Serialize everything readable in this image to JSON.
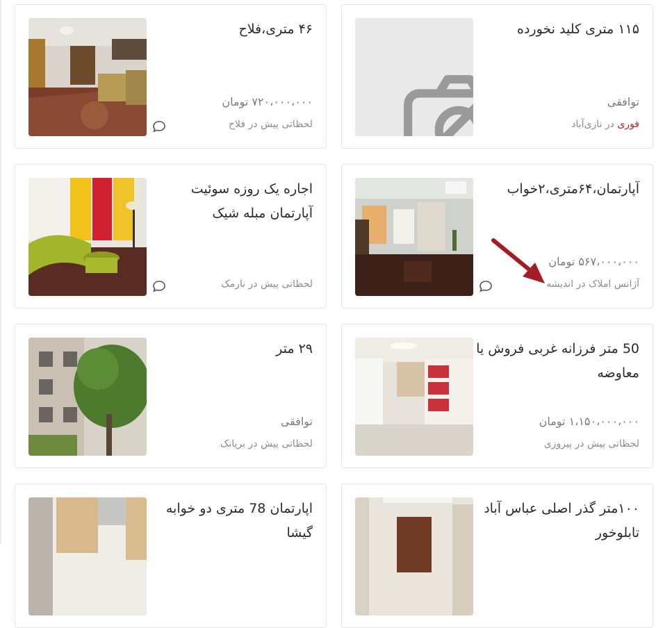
{
  "listings": [
    {
      "title": "۱۱۵ متری کلید نخورده",
      "price": "توافقی",
      "meta_urgent": "فوری",
      "meta_rest": " در نازی‌آباد",
      "has_image": false,
      "has_chat": false
    },
    {
      "title": "۴۶ متری،فلاح",
      "price": "۷۲۰،۰۰۰،۰۰۰ تومان",
      "meta_rest": "لحظاتی پیش در فلاح",
      "has_image": true,
      "has_chat": true
    },
    {
      "title": "آپارتمان،۶۴متری،۲خواب",
      "price": "۵۶۷،۰۰۰،۰۰۰ تومان",
      "meta_rest": "آژانس املاک در اندیشه",
      "has_image": true,
      "has_chat": true
    },
    {
      "title": "اجاره یک روزه سوئیت آپارتمان مبله شیک",
      "price": "",
      "meta_rest": "لحظاتی پیش در نارمک",
      "has_image": true,
      "has_chat": true
    },
    {
      "title": "50 متر فرزانه غربی فروش یا معاوضه",
      "price": "۱،۱۵۰،۰۰۰،۰۰۰ تومان",
      "meta_rest": "لحظاتی پیش در پیروزی",
      "has_image": true,
      "has_chat": false
    },
    {
      "title": "۲۹ متر",
      "price": "توافقی",
      "meta_rest": "لحظاتی پیش در بریانک",
      "has_image": true,
      "has_chat": false
    },
    {
      "title": "۱۰۰متر گذر اصلی عباس آباد تابلوخور",
      "price": "",
      "meta_rest": "",
      "has_image": true,
      "has_chat": false
    },
    {
      "title": "اپارتمان 78 متری دو خوابه گیشا",
      "price": "",
      "meta_rest": "",
      "has_image": true,
      "has_chat": false
    }
  ],
  "icons": {
    "chat": "chat-bubble-icon",
    "no_image": "image-off-icon",
    "annotation": "red-arrow-annotation"
  },
  "colors": {
    "urgent": "#b3261e",
    "arrow": "#a51d24"
  }
}
